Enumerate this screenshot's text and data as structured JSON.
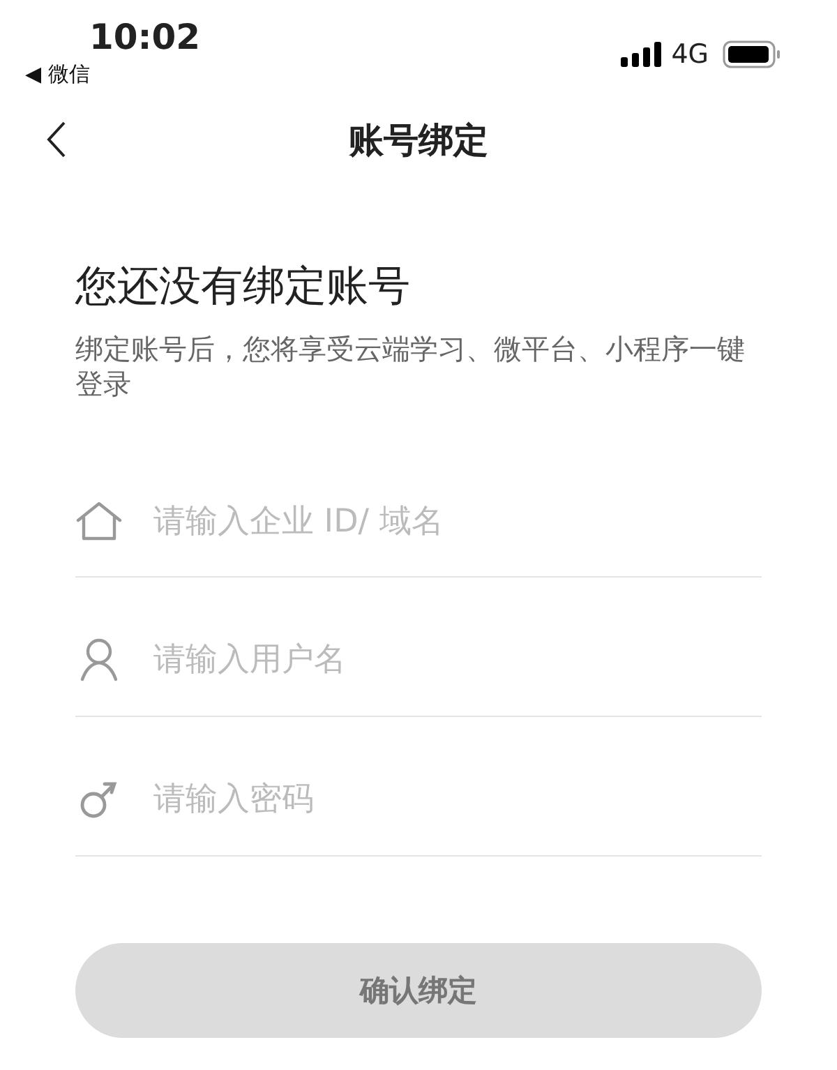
{
  "status_bar": {
    "time": "10:02",
    "back_app": "◀ 微信",
    "network": "4G"
  },
  "nav": {
    "title": "账号绑定"
  },
  "heading": "您还没有绑定账号",
  "subtitle": "绑定账号后，您将享受云端学习、微平台、小程序一键登录",
  "fields": [
    {
      "kind": "company",
      "placeholder": "请输入企业 ID/ 域名"
    },
    {
      "kind": "user",
      "placeholder": "请输入用户名"
    },
    {
      "kind": "password",
      "placeholder": "请输入密码"
    }
  ],
  "confirm_button": {
    "label": "确认绑定",
    "disabled": true
  }
}
